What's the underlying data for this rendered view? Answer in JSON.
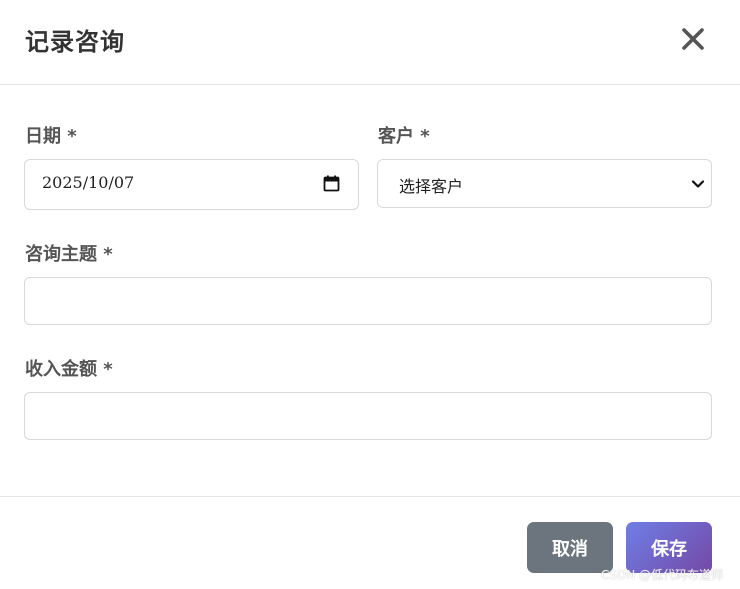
{
  "dialog": {
    "title": "记录咨询",
    "close_icon": "close-icon"
  },
  "form": {
    "date": {
      "label": "日期 *",
      "value": "2025/10/07",
      "icon": "calendar-icon"
    },
    "customer": {
      "label": "客户 *",
      "selected": "选择客户",
      "icon": "chevron-down-icon"
    },
    "subject": {
      "label": "咨询主题 *",
      "value": ""
    },
    "income": {
      "label": "收入金额 *",
      "value": ""
    }
  },
  "footer": {
    "cancel_label": "取消",
    "save_label": "保存"
  },
  "watermark": "CSDN @低代码布道师",
  "colors": {
    "cancel_bg": "#6c757d",
    "save_gradient_start": "#6f7fe6",
    "save_gradient_end": "#7448a6",
    "label_text": "#555555"
  }
}
